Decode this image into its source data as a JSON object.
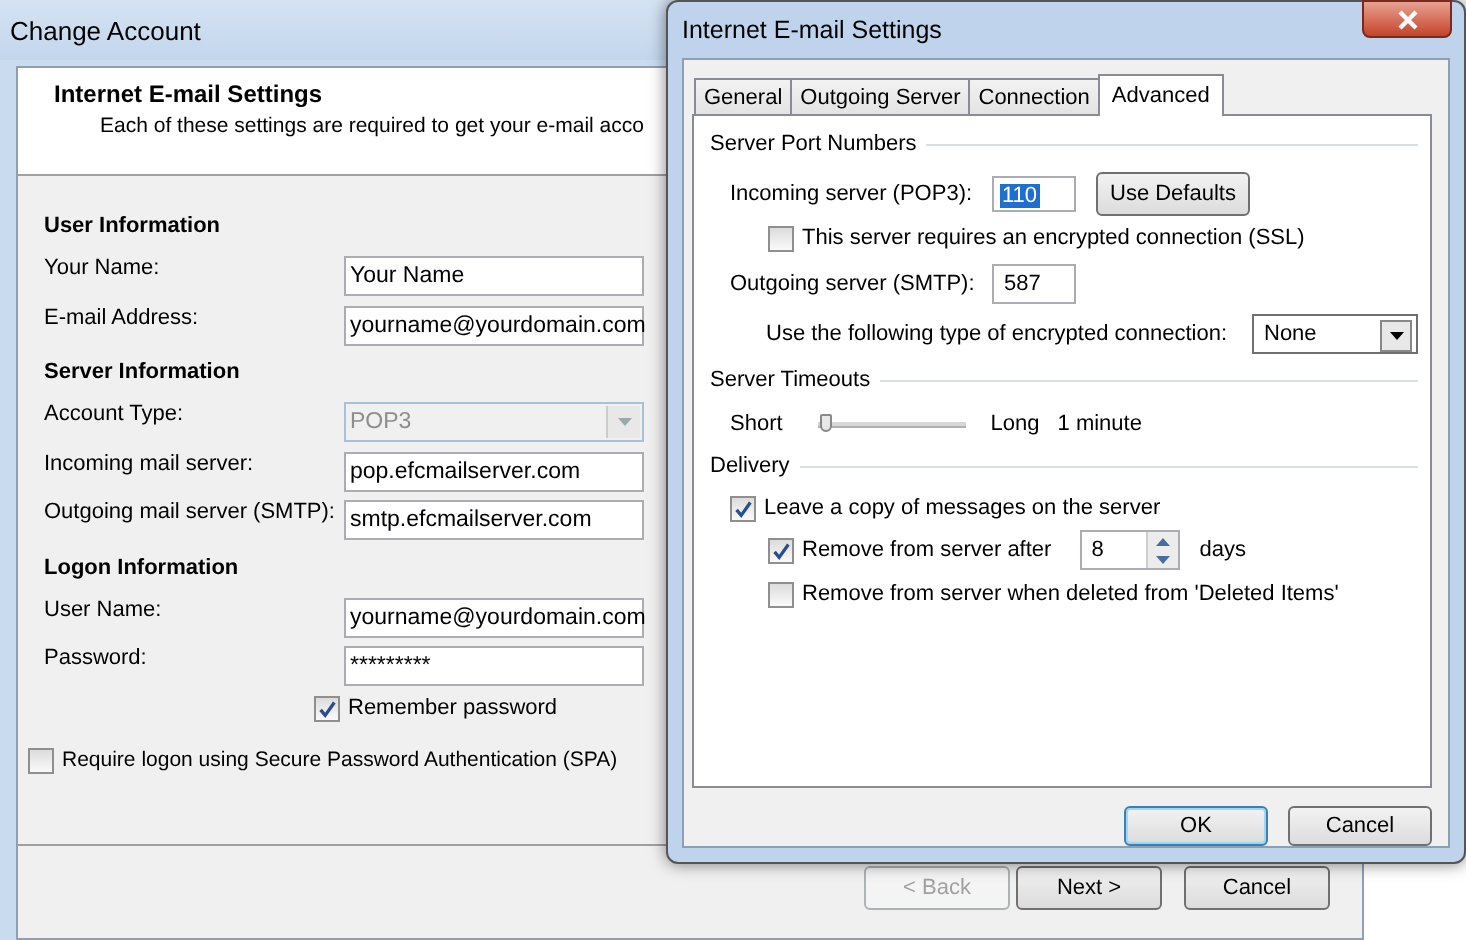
{
  "back_window": {
    "title": "Change Account",
    "header": {
      "title": "Internet E-mail Settings",
      "subtitle": "Each of these settings are required to get your e-mail acco"
    },
    "sections": [
      {
        "heading": "User Information",
        "rows": [
          {
            "label": "Your Name:",
            "kind": "text",
            "value": "Your Name"
          },
          {
            "label": "E-mail Address:",
            "kind": "text",
            "value": "yourname@yourdomain.com"
          }
        ]
      },
      {
        "heading": "Server Information",
        "rows": [
          {
            "label": "Account Type:",
            "kind": "select",
            "value": "POP3",
            "disabled": true
          },
          {
            "label": "Incoming mail server:",
            "kind": "text",
            "value": "pop.efcmailserver.com"
          },
          {
            "label": "Outgoing mail server (SMTP):",
            "kind": "text",
            "value": "smtp.efcmailserver.com"
          }
        ]
      },
      {
        "heading": "Logon Information",
        "rows": [
          {
            "label": "User Name:",
            "kind": "text",
            "value": "yourname@yourdomain.com"
          },
          {
            "label": "Password:",
            "kind": "password",
            "value": "*********"
          }
        ]
      }
    ],
    "remember": {
      "label": "Remember password",
      "checked": true
    },
    "spa": {
      "label": "Require logon using Secure Password Authentication (SPA)",
      "checked": false
    },
    "buttons": [
      {
        "label": "< Back",
        "disabled": true
      },
      {
        "label": "Next >",
        "disabled": false
      },
      {
        "label": "Cancel",
        "disabled": false
      }
    ]
  },
  "dialog": {
    "title": "Internet E-mail Settings",
    "tabs": [
      {
        "label": "General",
        "selected": false
      },
      {
        "label": "Outgoing Server",
        "selected": false
      },
      {
        "label": "Connection",
        "selected": false
      },
      {
        "label": "Advanced",
        "selected": true
      }
    ],
    "ports": {
      "title": "Server Port Numbers",
      "incoming": {
        "label": "Incoming server (POP3):",
        "value": "110"
      },
      "use_defaults": "Use Defaults",
      "ssl": {
        "label": "This server requires an encrypted connection (SSL)",
        "checked": false
      },
      "outgoing": {
        "label": "Outgoing server (SMTP):",
        "value": "587"
      },
      "encryption": {
        "label": "Use the following type of encrypted connection:",
        "value": "None"
      }
    },
    "timeouts": {
      "title": "Server Timeouts",
      "min_label": "Short",
      "max_label": "Long",
      "level": 0.05,
      "reading": "1 minute"
    },
    "delivery": {
      "title": "Delivery",
      "leave_copy": {
        "label": "Leave a copy of messages on the server",
        "checked": true
      },
      "remove_after": {
        "label": "Remove from server after",
        "checked": true,
        "value": "8",
        "unit": "days"
      },
      "remove_deleted": {
        "label": "Remove from server when deleted from 'Deleted Items'",
        "checked": false
      }
    },
    "buttons": [
      {
        "label": "OK",
        "default": true
      },
      {
        "label": "Cancel",
        "default": false
      }
    ]
  }
}
